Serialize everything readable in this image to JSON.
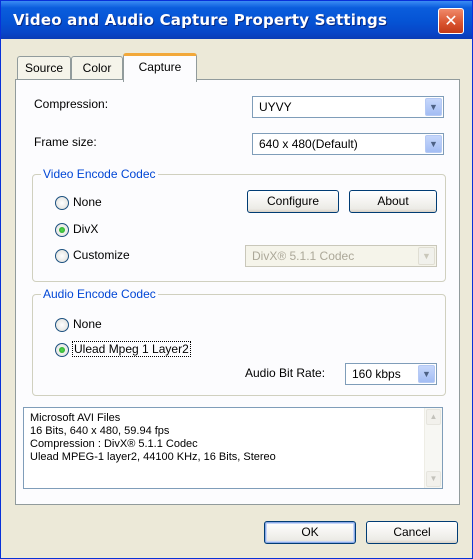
{
  "window": {
    "title": "Video and Audio Capture Property Settings",
    "close_glyph": "✕"
  },
  "tabs": [
    {
      "label": "Source",
      "active": false
    },
    {
      "label": "Color",
      "active": false
    },
    {
      "label": "Capture",
      "active": true
    }
  ],
  "capture": {
    "compression_label": "Compression:",
    "compression_value": "UYVY",
    "frame_size_label": "Frame size:",
    "frame_size_value": "640 x 480(Default)"
  },
  "video_codec": {
    "group_title": "Video Encode Codec",
    "options": [
      {
        "label": "None",
        "selected": false
      },
      {
        "label": "DivX",
        "selected": true
      },
      {
        "label": "Customize",
        "selected": false
      }
    ],
    "configure_label": "Configure",
    "about_label": "About",
    "customize_value": "DivX® 5.1.1 Codec"
  },
  "audio_codec": {
    "group_title": "Audio Encode Codec",
    "options": [
      {
        "label": "None",
        "selected": false
      },
      {
        "label": "Ulead Mpeg 1 Layer2",
        "selected": true
      }
    ],
    "bitrate_label": "Audio Bit Rate:",
    "bitrate_value": "160 kbps"
  },
  "info_lines": [
    "Microsoft AVI Files",
    "16 Bits, 640 x 480, 59.94 fps",
    "Compression : DivX® 5.1.1 Codec",
    "Ulead MPEG-1 layer2, 44100 KHz, 16 Bits, Stereo"
  ],
  "footer": {
    "ok_label": "OK",
    "cancel_label": "Cancel"
  },
  "icons": {
    "dropdown_arrow": "▼",
    "scroll_up": "▲",
    "scroll_down": "▼"
  },
  "colors": {
    "title_bar": "#0553d4",
    "close_button": "#d8522e",
    "group_title": "#0046d5",
    "active_tab_accent": "#f2a83a"
  }
}
